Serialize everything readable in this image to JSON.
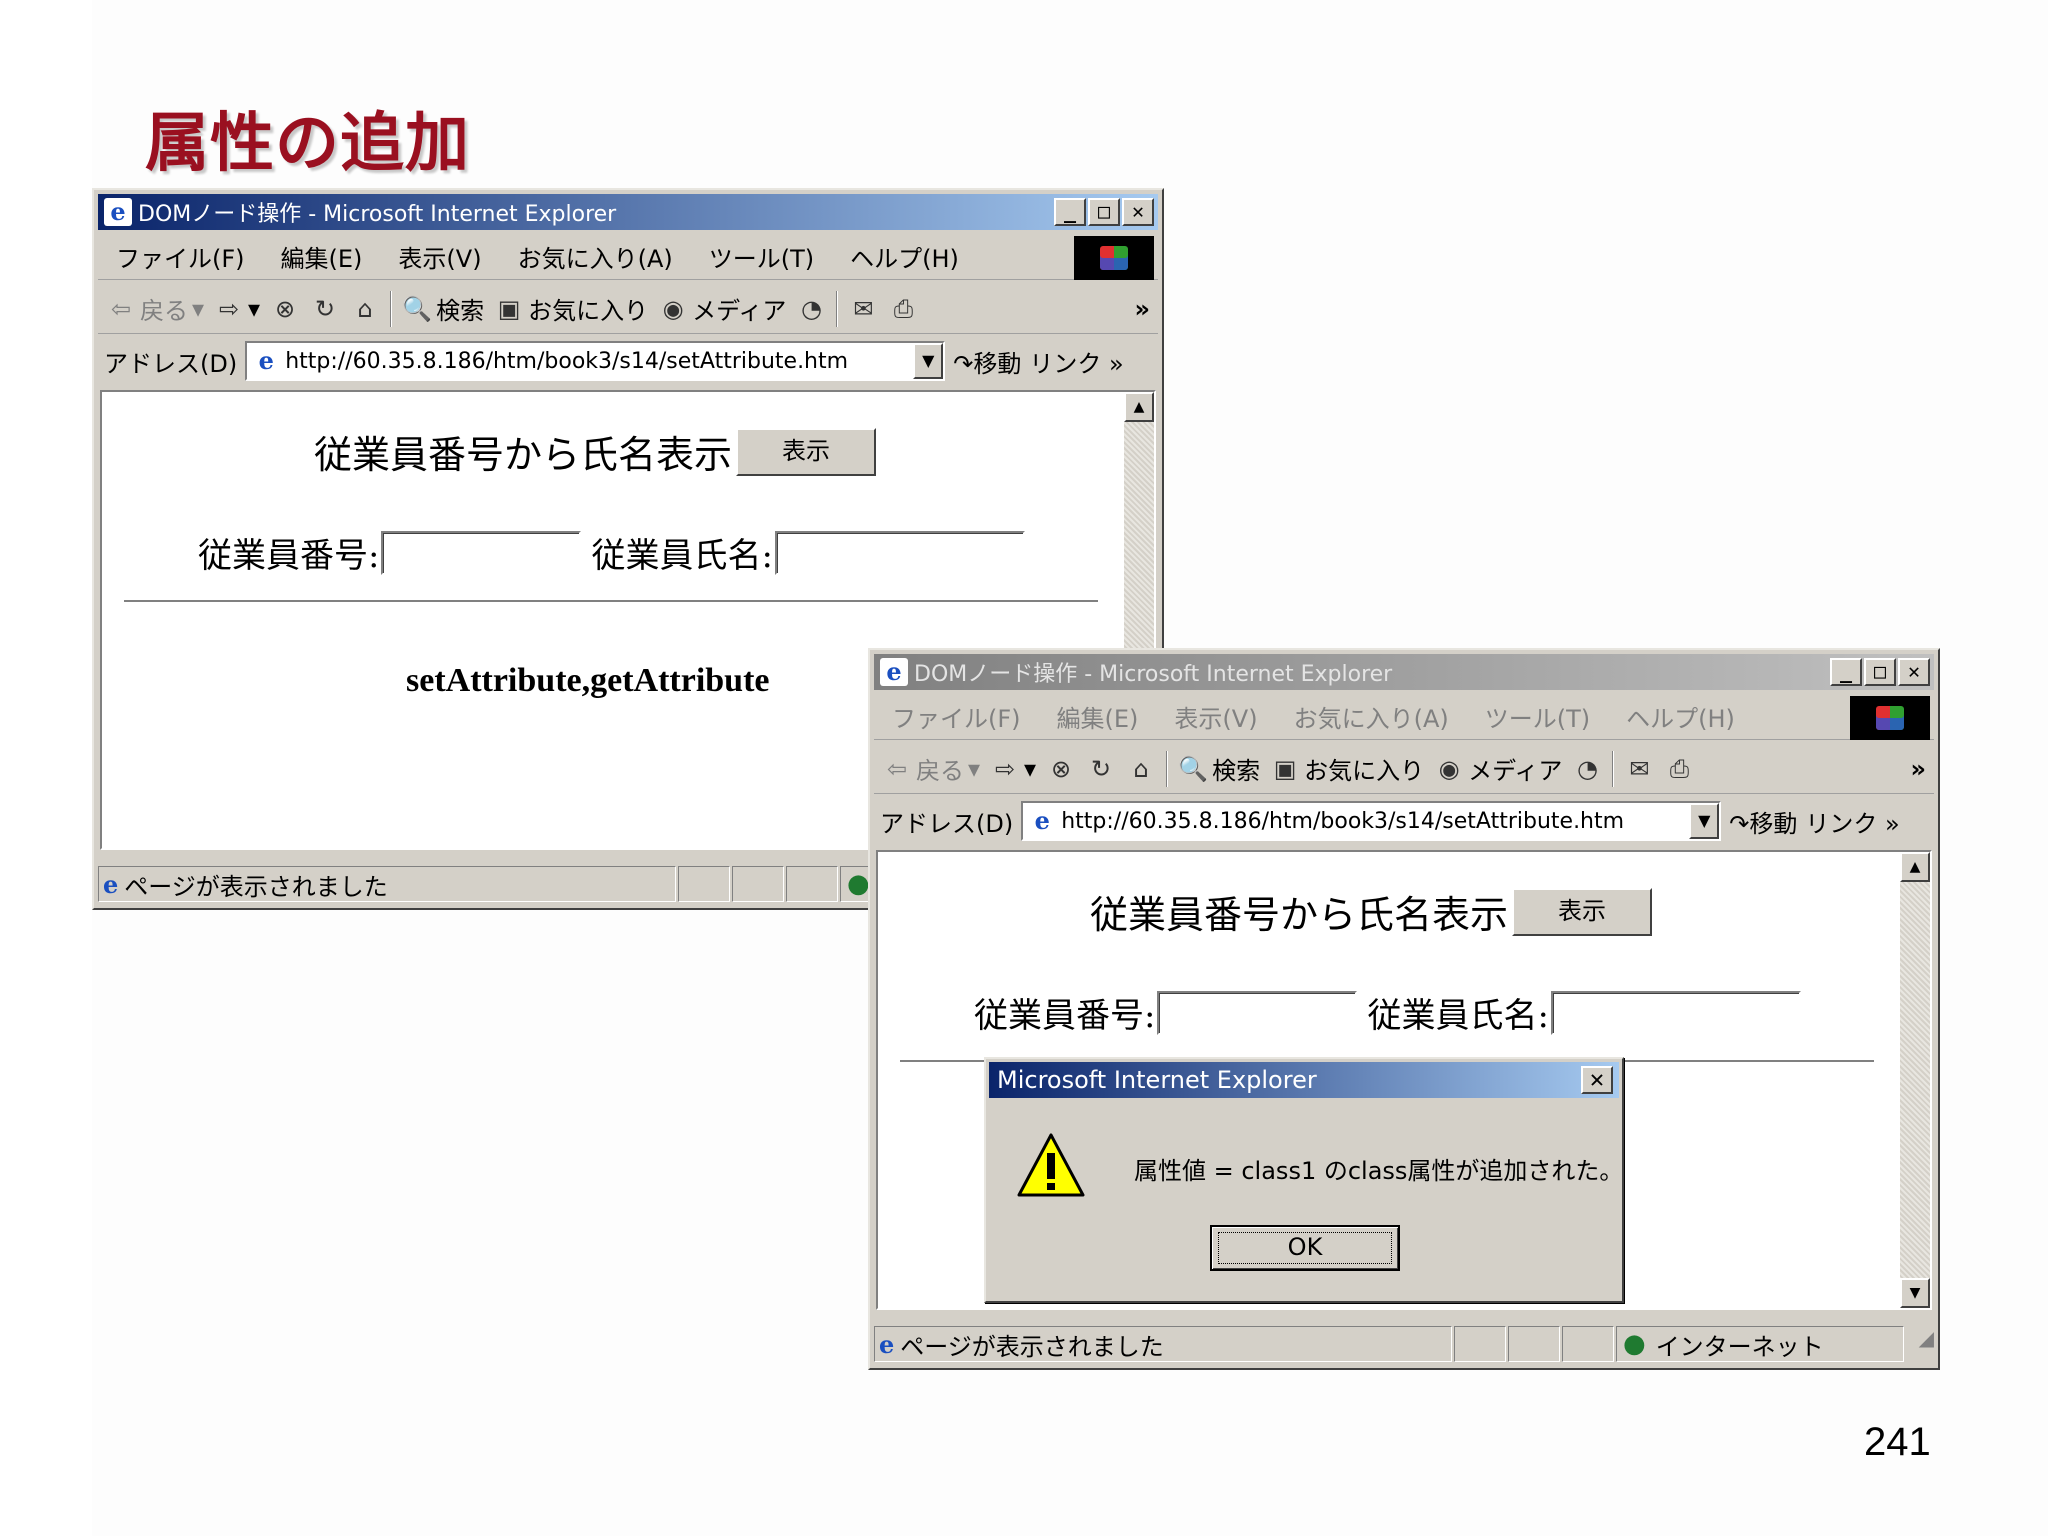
{
  "slide": {
    "title": "属性の追加",
    "page_number": "241"
  },
  "window": {
    "title": "DOMノード操作 - Microsoft Internet Explorer",
    "menu": [
      "ファイル(F)",
      "編集(E)",
      "表示(V)",
      "お気に入り(A)",
      "ツール(T)",
      "ヘルプ(H)"
    ],
    "toolbar": {
      "back": "戻る",
      "search": "検索",
      "favorites": "お気に入り",
      "media": "メディア",
      "more": "»"
    },
    "address": {
      "label": "アドレス(D)",
      "url": "http://60.35.8.186/htm/book3/s14/setAttribute.htm",
      "go": "移動",
      "links": "リンク »"
    },
    "page": {
      "heading": "従業員番号から氏名表示",
      "show_button": "表示",
      "emp_number_label": "従業員番号:",
      "emp_name_label": "従業員氏名:",
      "caption": "setAttribute,getAttribute"
    },
    "status": {
      "message": "ページが表示されました",
      "zone": "インターネット"
    }
  },
  "dialog": {
    "title": "Microsoft Internet Explorer",
    "message": "属性値 = class1 のclass属性が追加された。",
    "ok": "OK"
  }
}
